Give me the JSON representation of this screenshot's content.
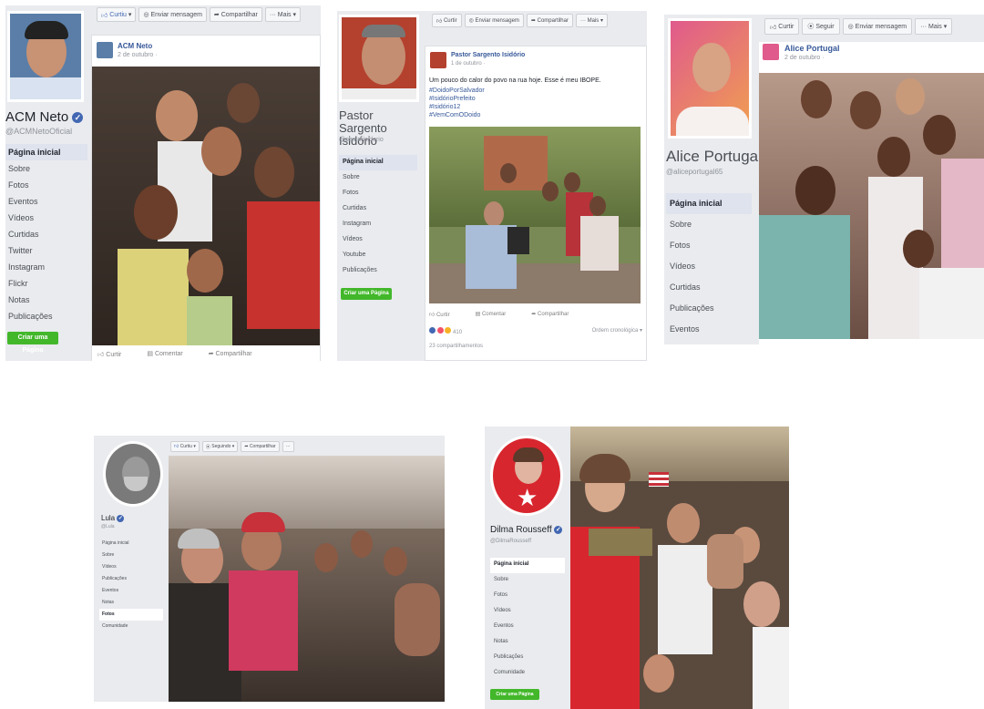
{
  "panels": [
    {
      "page_name": "ACM Neto",
      "handle": "@ACMNetoOficial",
      "verified": true,
      "actions": [
        "Curtiu",
        "Enviar mensagem",
        "Compartilhar",
        "Mais"
      ],
      "nav": [
        "Página inicial",
        "Sobre",
        "Fotos",
        "Eventos",
        "Vídeos",
        "Curtidas",
        "Twitter",
        "Instagram",
        "Flickr",
        "Notas",
        "Publicações"
      ],
      "active_nav": 0,
      "create_page": "Criar uma Página",
      "post": {
        "author": "ACM Neto",
        "date": "2 de outubro ·",
        "footer": [
          "Curtir",
          "Comentar",
          "Compartilhar"
        ]
      }
    },
    {
      "page_name": "Pastor Sargento Isidório",
      "handle": "@pastorisidorio",
      "actions": [
        "Curtir",
        "Enviar mensagem",
        "Compartilhar",
        "Mais"
      ],
      "nav": [
        "Página inicial",
        "Sobre",
        "Fotos",
        "Curtidas",
        "Instagram",
        "Vídeos",
        "Youtube",
        "Publicações"
      ],
      "active_nav": 0,
      "create_page": "Criar uma Página",
      "post": {
        "author": "Pastor Sargento Isidório",
        "date": "1 de outubro ·",
        "text": "Um pouco do calor do povo na rua hoje. Esse é meu IBOPE.",
        "hashtags": [
          "#DoidoPorSalvador",
          "#IsidórioPrefeito",
          "#Isidório12",
          "#VemComODoido"
        ],
        "footer": [
          "Curtir",
          "Comentar",
          "Compartilhar"
        ],
        "reactions": "410",
        "order": "Ordem cronológica",
        "shares": "23 compartilhamentos"
      }
    },
    {
      "page_name": "Alice Portugal",
      "handle": "@aliceportugal65",
      "verified": true,
      "actions": [
        "Curtir",
        "Seguir",
        "Enviar mensagem",
        "Mais"
      ],
      "nav": [
        "Página inicial",
        "Sobre",
        "Fotos",
        "Vídeos",
        "Curtidas",
        "Publicações",
        "Eventos"
      ],
      "active_nav": 0,
      "post": {
        "author": "Alice Portugal",
        "date": "2 de outubro ·"
      }
    },
    {
      "page_name": "Lula",
      "handle": "@Lula",
      "verified": true,
      "actions": [
        "Curtiu",
        "Seguindo",
        "Compartilhar",
        "···"
      ],
      "nav": [
        "Página inicial",
        "Sobre",
        "Vídeos",
        "Publicações",
        "Eventos",
        "Notas",
        "Fotos",
        "Comunidade"
      ],
      "active_nav": 6
    },
    {
      "page_name": "Dilma Rousseff",
      "handle": "@DilmaRousseff",
      "verified": true,
      "nav": [
        "Página inicial",
        "Sobre",
        "Fotos",
        "Vídeos",
        "Eventos",
        "Notas",
        "Publicações",
        "Comunidade"
      ],
      "active_nav": 0,
      "create_page": "Criar uma Página"
    }
  ],
  "colors": {
    "facebook_blue": "#4267b2",
    "link_blue": "#365899",
    "create_green": "#42b72a",
    "sidebar_bg": "#e9ebee"
  },
  "icons": {
    "like": "like-icon",
    "message": "message-icon",
    "share": "share-icon",
    "more": "more-icon",
    "follow": "follow-icon",
    "verified": "verified-badge-icon"
  }
}
